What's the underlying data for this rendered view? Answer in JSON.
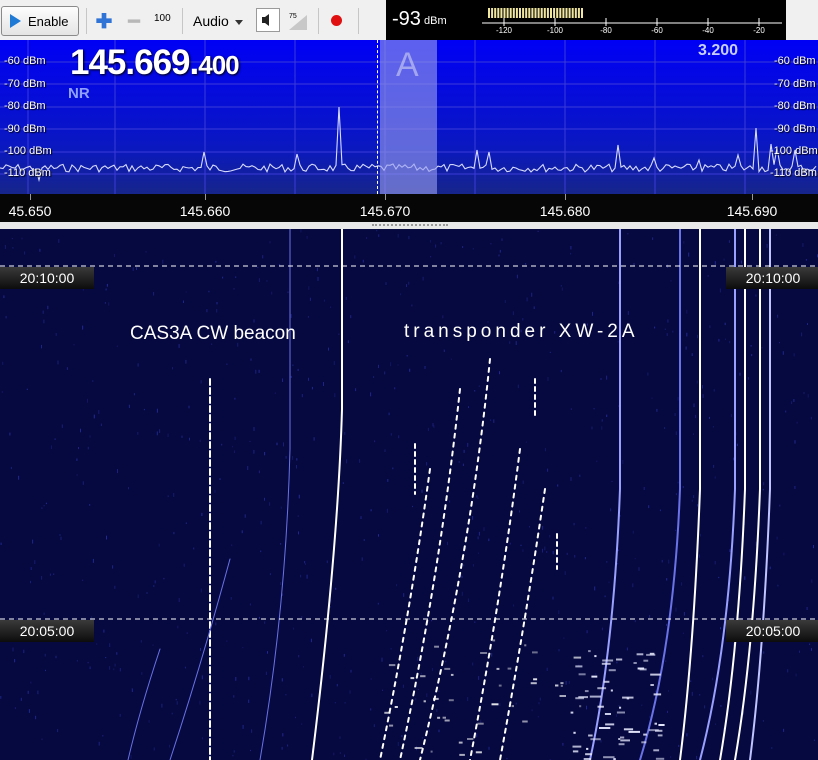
{
  "toolbar": {
    "enable_label": "Enable",
    "zoom_value": "100",
    "audio_label": "Audio",
    "volume_value": "75"
  },
  "smeter": {
    "level": "-93",
    "unit": "dBm",
    "scale": [
      "-120",
      "-100",
      "-80",
      "-60",
      "-40",
      "-20"
    ]
  },
  "spectrum": {
    "frequency_main": "145.669.",
    "frequency_sub": "400",
    "nr_label": "NR",
    "bandwidth": "3.200",
    "vfo_label": "A",
    "dbm_left": [
      "-60 dBm",
      "-70 dBm",
      "-80 dBm",
      "-90 dBm",
      "-100 dBm",
      "-110 dBm"
    ],
    "dbm_right": [
      "-60 dBm",
      "-70 dBm",
      "-80 dBm",
      "-90 dBm",
      "-100 dBm",
      "-110 dBm"
    ]
  },
  "freq_axis": {
    "labels": [
      "45.650",
      "145.660",
      "145.670",
      "145.680",
      "145.690"
    ]
  },
  "waterfall": {
    "times_left": [
      "20:10:00",
      "20:05:00"
    ],
    "times_right": [
      "20:10:00",
      "20:05:00"
    ],
    "annotation_beacon": "CAS3A CW beacon",
    "annotation_transponder": "transponder XW-2A"
  },
  "colors": {
    "spectrum_bg_top": "#0000ff",
    "spectrum_bg_bottom": "#0d1f9a",
    "waterfall_bg": "#06093f",
    "record": "#e01010"
  }
}
